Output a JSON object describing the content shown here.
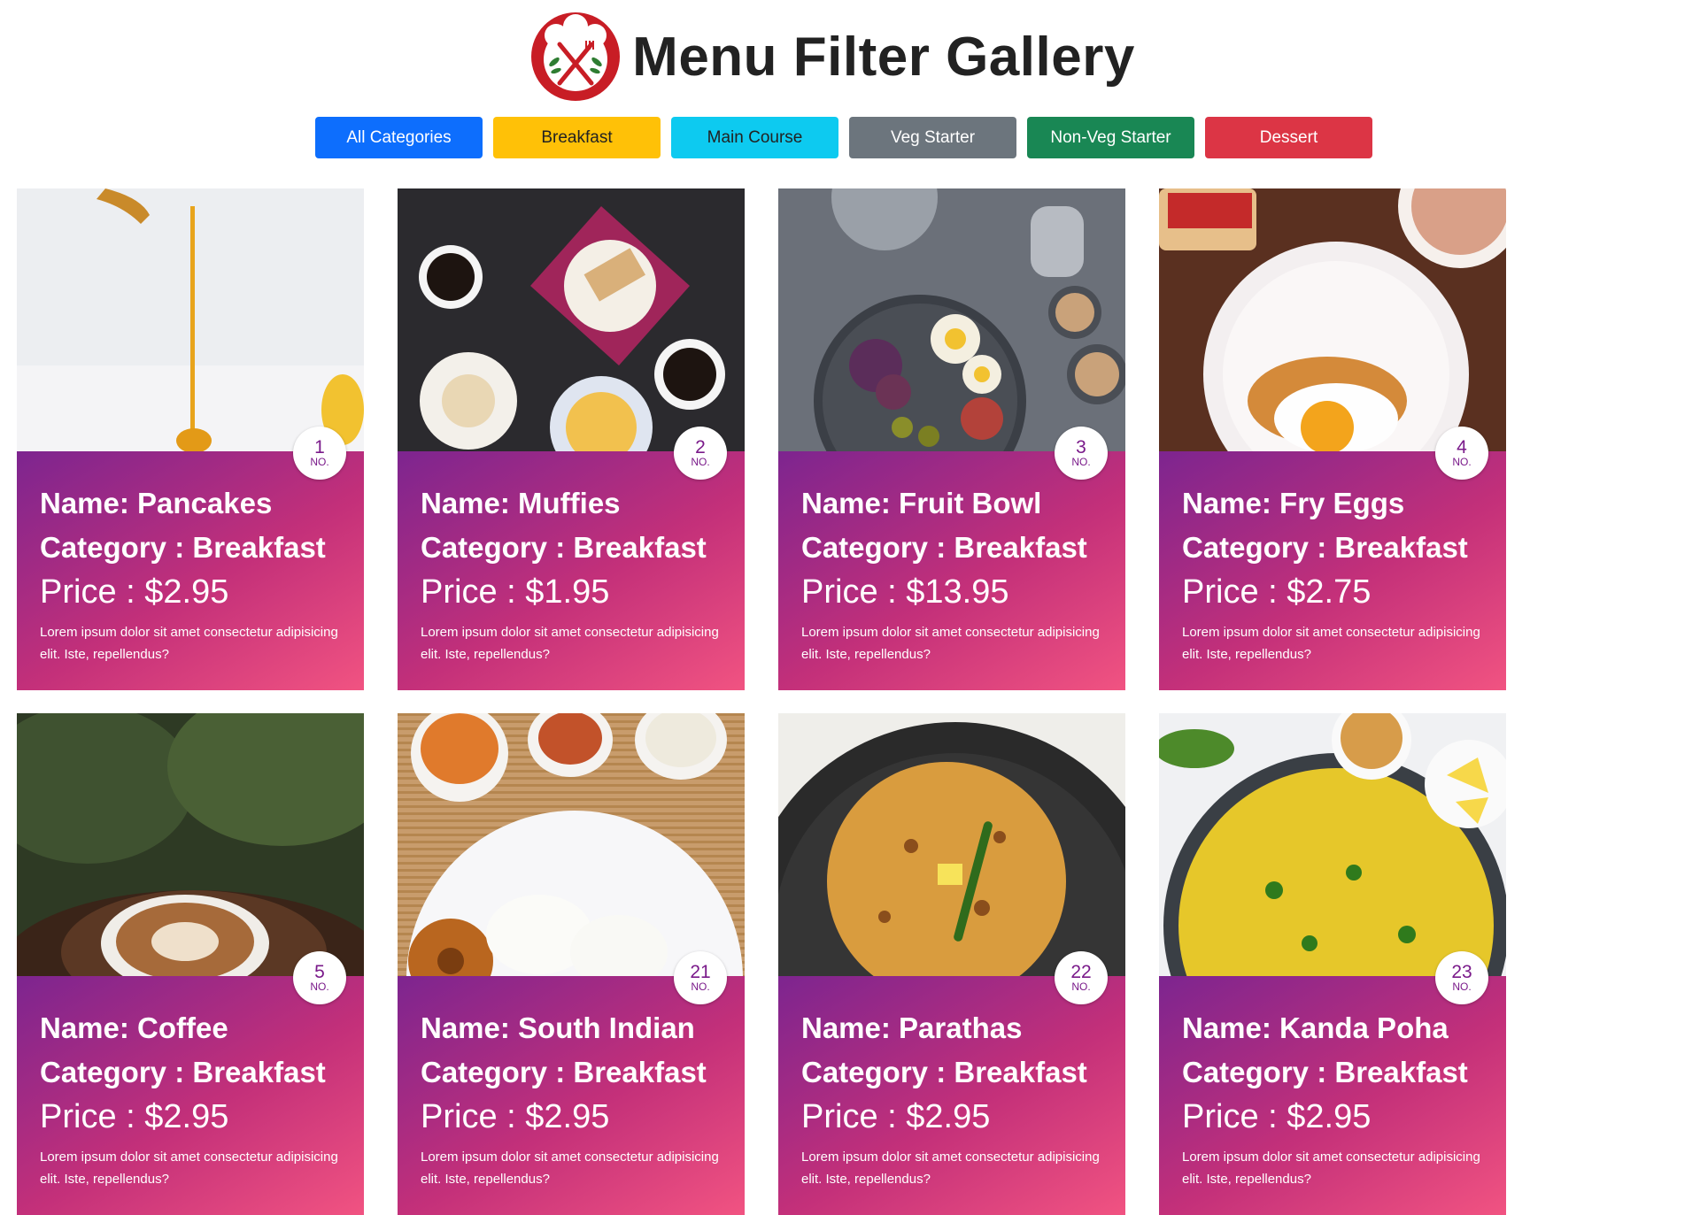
{
  "header": {
    "title": "Menu Filter Gallery",
    "logo_icon": "restaurant-fork-knife-logo-icon",
    "logo_color": "#c81d25"
  },
  "filters": [
    {
      "label": "All Categories",
      "color": "#0d6efd",
      "text_color": "#ffffff"
    },
    {
      "label": "Breakfast",
      "color": "#ffc107",
      "text_color": "#222222"
    },
    {
      "label": "Main Course",
      "color": "#0dcaf0",
      "text_color": "#222222"
    },
    {
      "label": "Veg Starter",
      "color": "#6c757d",
      "text_color": "#ffffff"
    },
    {
      "label": "Non-Veg Starter",
      "color": "#198754",
      "text_color": "#ffffff"
    },
    {
      "label": "Dessert",
      "color": "#dc3545",
      "text_color": "#ffffff"
    }
  ],
  "cards": [
    {
      "no": "1",
      "no_label": "NO.",
      "name": "Name: Pancakes",
      "category": "Category : Breakfast",
      "price": "Price : $2.95",
      "desc": "Lorem ipsum dolor sit amet consectetur adipisicing elit. Iste, repellendus?",
      "photo": "pancakes-honey-photo"
    },
    {
      "no": "2",
      "no_label": "NO.",
      "name": "Name: Muffies",
      "category": "Category : Breakfast",
      "price": "Price : $1.95",
      "desc": "Lorem ipsum dolor sit amet consectetur adipisicing elit. Iste, repellendus?",
      "photo": "coffee-pastry-table-photo"
    },
    {
      "no": "3",
      "no_label": "NO.",
      "name": "Name: Fruit Bowl",
      "category": "Category : Breakfast",
      "price": "Price : $13.95",
      "desc": "Lorem ipsum dolor sit amet consectetur adipisicing elit. Iste, repellendus?",
      "photo": "fruit-platter-photo"
    },
    {
      "no": "4",
      "no_label": "NO.",
      "name": "Name: Fry Eggs",
      "category": "Category : Breakfast",
      "price": "Price : $2.75",
      "desc": "Lorem ipsum dolor sit amet consectetur adipisicing elit. Iste, repellendus?",
      "photo": "fried-egg-toast-photo"
    },
    {
      "no": "5",
      "no_label": "NO.",
      "name": "Name: Coffee",
      "category": "Category : Breakfast",
      "price": "Price : $2.95",
      "desc": "Lorem ipsum dolor sit amet consectetur adipisicing elit. Iste, repellendus?",
      "photo": "latte-cup-photo"
    },
    {
      "no": "21",
      "no_label": "NO.",
      "name": "Name: South Indian",
      "category": "Category : Breakfast",
      "price": "Price : $2.95",
      "desc": "Lorem ipsum dolor sit amet consectetur adipisicing elit. Iste, repellendus?",
      "photo": "idli-vada-plate-photo"
    },
    {
      "no": "22",
      "no_label": "NO.",
      "name": "Name: Parathas",
      "category": "Category : Breakfast",
      "price": "Price : $2.95",
      "desc": "Lorem ipsum dolor sit amet consectetur adipisicing elit. Iste, repellendus?",
      "photo": "paratha-pan-photo"
    },
    {
      "no": "23",
      "no_label": "NO.",
      "name": "Name: Kanda Poha",
      "category": "Category : Breakfast",
      "price": "Price : $2.95",
      "desc": "Lorem ipsum dolor sit amet consectetur adipisicing elit. Iste, repellendus?",
      "photo": "poha-pan-photo"
    }
  ]
}
